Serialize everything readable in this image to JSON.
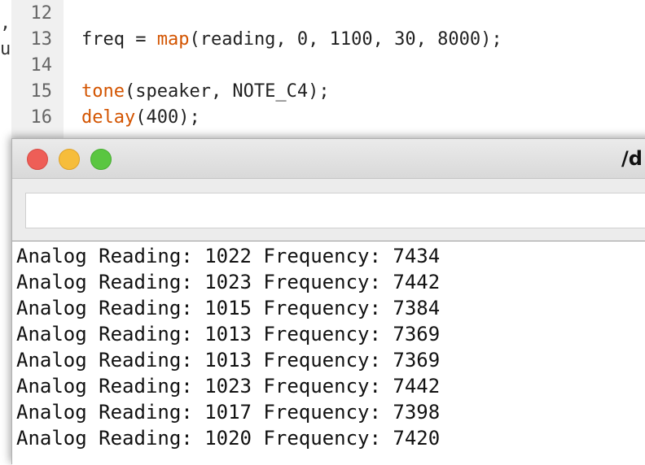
{
  "editor": {
    "left_edge_fragments": [
      ",",
      "u"
    ],
    "lines": [
      {
        "number": "12",
        "tokens": []
      },
      {
        "number": "13",
        "tokens": [
          {
            "text": "freq = ",
            "kind": "plain"
          },
          {
            "text": "map",
            "kind": "kw"
          },
          {
            "text": "(reading, 0, 1100, 30, 8000);",
            "kind": "plain"
          }
        ]
      },
      {
        "number": "14",
        "tokens": []
      },
      {
        "number": "15",
        "tokens": [
          {
            "text": "tone",
            "kind": "kw"
          },
          {
            "text": "(speaker, NOTE_C4);",
            "kind": "plain"
          }
        ]
      },
      {
        "number": "16",
        "tokens": [
          {
            "text": "delay",
            "kind": "kw"
          },
          {
            "text": "(400);",
            "kind": "plain"
          }
        ]
      }
    ]
  },
  "serial_monitor": {
    "title": "/d",
    "input_value": "",
    "output_lines": [
      "Analog Reading: 1022 Frequency: 7434",
      "Analog Reading: 1023 Frequency: 7442",
      "Analog Reading: 1015 Frequency: 7384",
      "Analog Reading: 1013 Frequency: 7369",
      "Analog Reading: 1013 Frequency: 7369",
      "Analog Reading: 1023 Frequency: 7442",
      "Analog Reading: 1017 Frequency: 7398",
      "Analog Reading: 1020 Frequency: 7420"
    ]
  },
  "colors": {
    "keyword": "#d35400",
    "close": "#ee5e57",
    "minimize": "#f6bd3b",
    "maximize": "#5ac640"
  }
}
